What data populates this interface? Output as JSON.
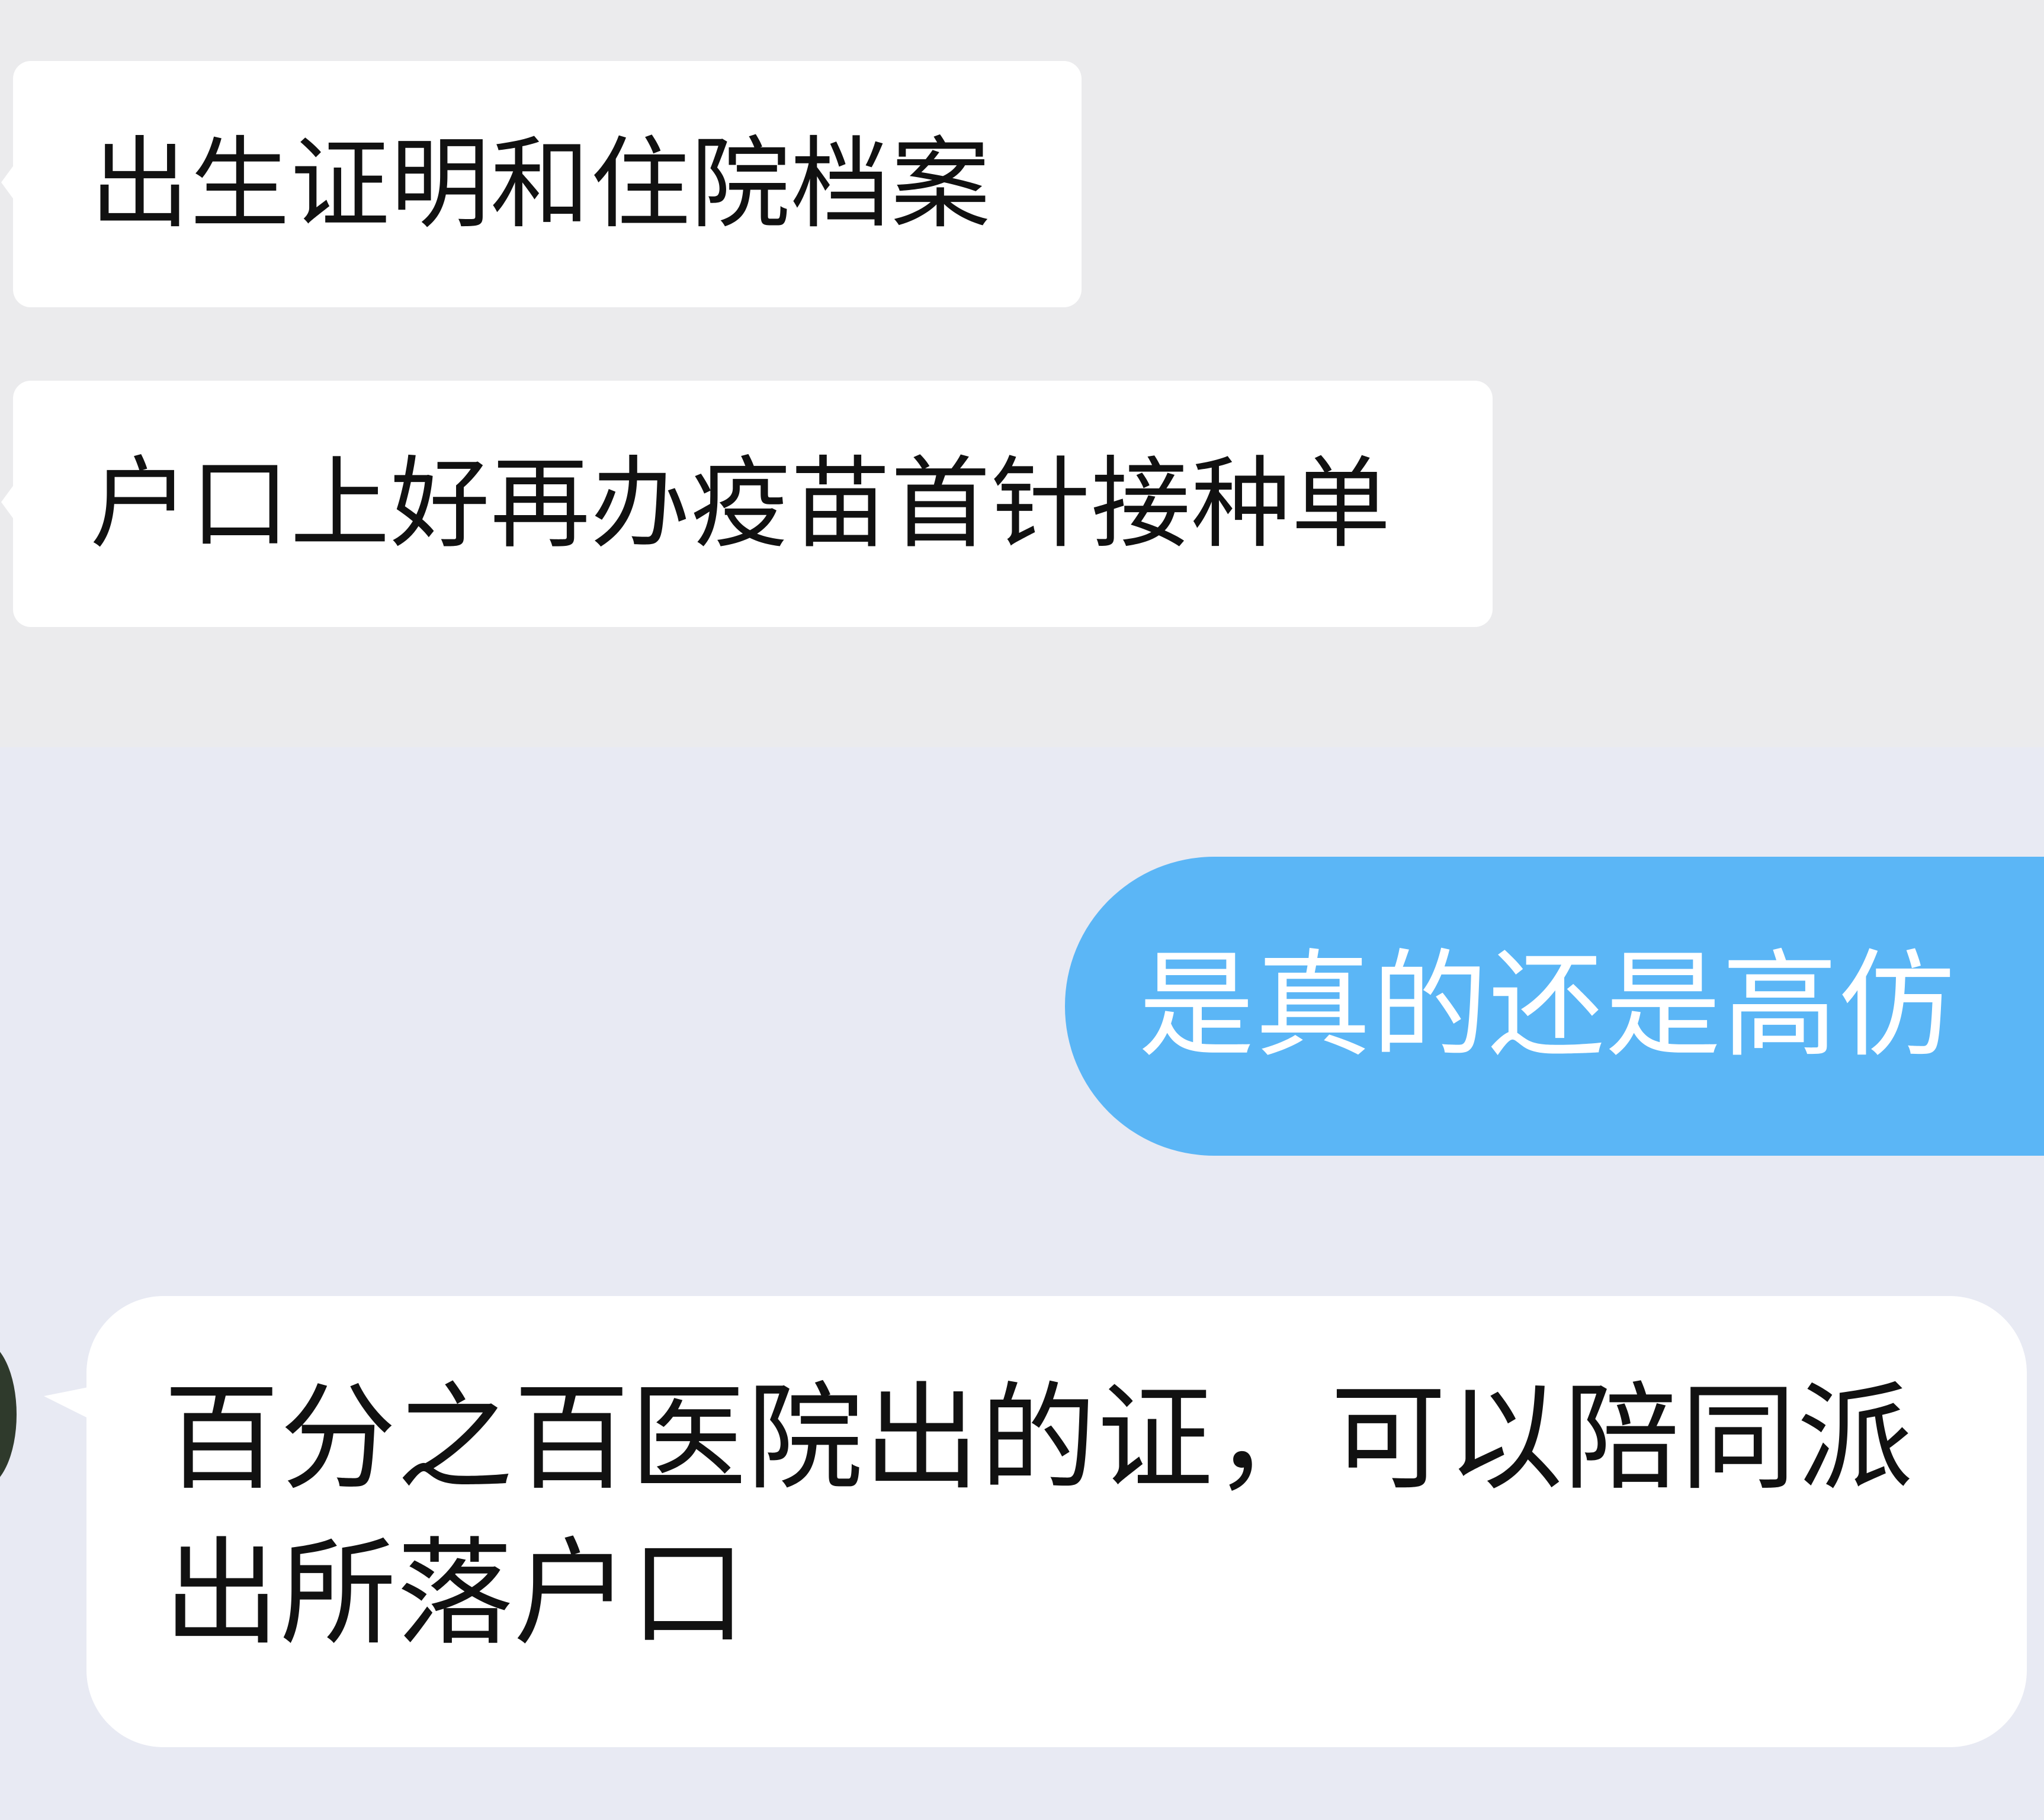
{
  "chat": {
    "messages": [
      {
        "side": "incoming",
        "text": "出生证明和住院档案"
      },
      {
        "side": "incoming",
        "text": "户口上好再办疫苗首针接种单"
      },
      {
        "side": "outgoing",
        "text": "是真的还是高仿"
      },
      {
        "side": "incoming",
        "lines": [
          "百分之百医院出的证，可以陪同派",
          "出所落户口"
        ]
      }
    ]
  },
  "colors": {
    "top_background": "#ebebed",
    "bottom_background": "#e8eaf3",
    "incoming_bubble": "#ffffff",
    "outgoing_bubble": "#5bb6f6",
    "outgoing_text": "#ffffff"
  }
}
